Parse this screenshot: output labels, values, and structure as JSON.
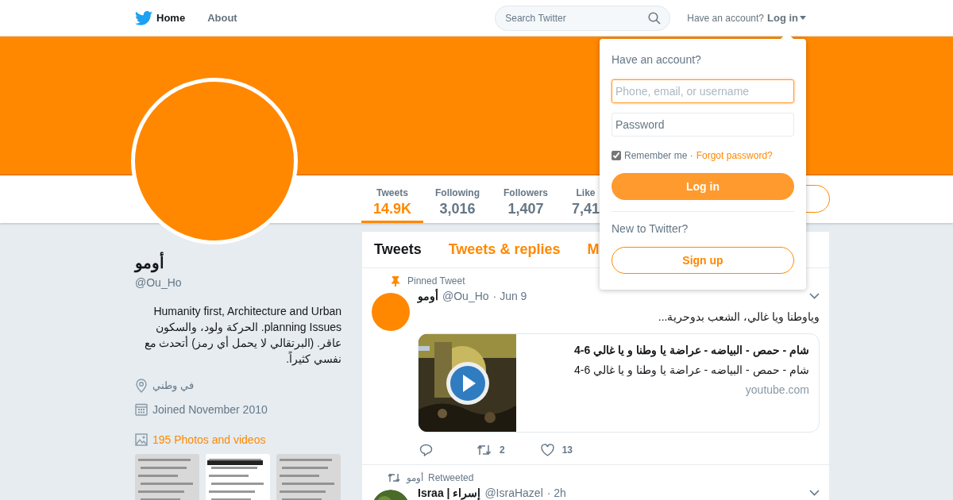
{
  "nav": {
    "items": [
      {
        "label": "Home",
        "selected": true
      },
      {
        "label": "About",
        "selected": false
      }
    ],
    "search_placeholder": "Search Twitter",
    "account_prompt": "Have an account?",
    "login_link": "Log in"
  },
  "profile": {
    "name": "أومو",
    "handle": "@Ou_Ho",
    "bio": "Humanity first, Architecture and Urban planning Issues. الحركة ولود، والسكون عاقر. (البرتقالي لا يحمل أي رمز) أتحدث مع نفسي كثيراً.",
    "location": "في وطني",
    "joined": "Joined November 2010",
    "photos_link": "195 Photos and videos"
  },
  "stats": [
    {
      "label": "Tweets",
      "value": "14.9K",
      "selected": true
    },
    {
      "label": "Following",
      "value": "3,016",
      "selected": false
    },
    {
      "label": "Followers",
      "value": "1,407",
      "selected": false
    },
    {
      "label": "Like",
      "value": "7,41",
      "selected": false
    }
  ],
  "timeline_tabs": [
    {
      "label": "Tweets",
      "selected": true
    },
    {
      "label": "Tweets & replies",
      "selected": false
    },
    {
      "label": "M",
      "selected": false
    }
  ],
  "tweets": [
    {
      "kind": "pinned",
      "context": "Pinned Tweet",
      "name": "أومو",
      "handle": "@Ou_Ho",
      "time": "· Jun 9",
      "text": "وياوطنا ويا غالي، الشعب بدوحرية...",
      "card": {
        "title": "شام - حمص - البياضه - عراضة يا وطنا و يا غالي 6-4",
        "description": "شام - حمص - البياضه - عراضة يا وطنا و يا غالي 6-4",
        "domain": "youtube.com"
      },
      "retweets": "2",
      "likes": "13"
    },
    {
      "kind": "retweet",
      "context_name": "أومو",
      "context": "Retweeted",
      "name": "Israa | إسراء",
      "handle": "@IsraHazel",
      "time": "· 2h"
    }
  ],
  "login_dropdown": {
    "title": "Have an account?",
    "username_placeholder": "Phone, email, or username",
    "password_placeholder": "Password",
    "remember": "Remember me ·",
    "remember_checked": true,
    "forgot": "Forgot password?",
    "login_button": "Log in",
    "new_prompt": "New to Twitter?",
    "signup_button": "Sign up"
  }
}
